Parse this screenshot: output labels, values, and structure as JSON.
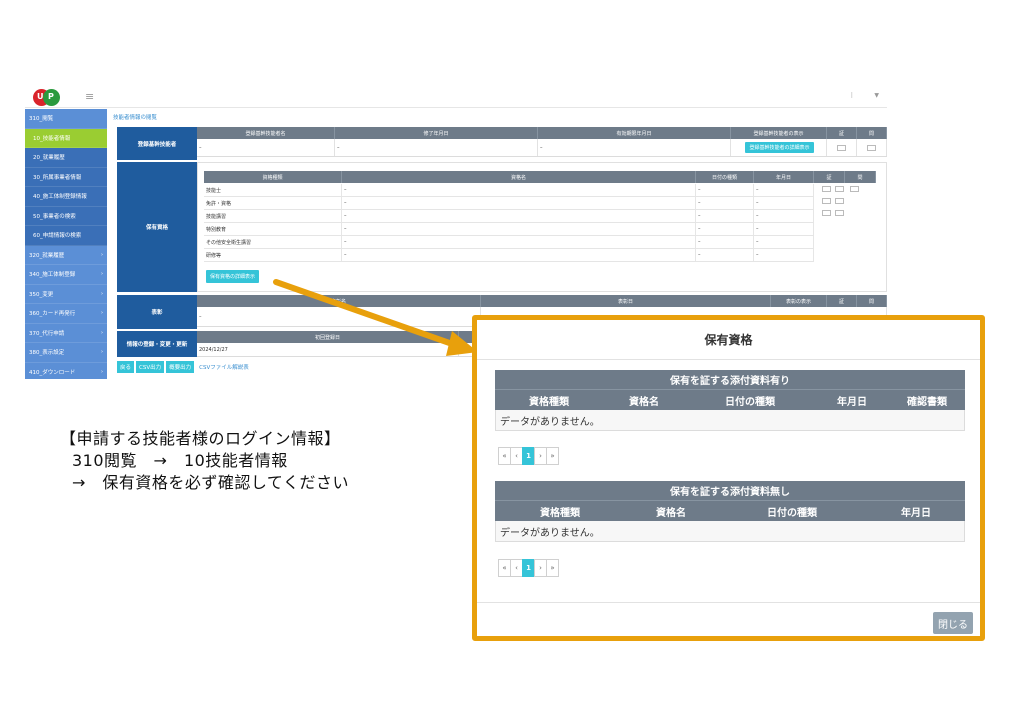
{
  "header": {
    "logo_text_1": "U",
    "logo_text_2": "P",
    "menu_icon": "menu-icon"
  },
  "sidebar": {
    "items": [
      {
        "label": "310_閲覧",
        "type": "top"
      },
      {
        "label": "10_技能者情報",
        "type": "active"
      },
      {
        "label": "20_就業履歴",
        "type": "sub"
      },
      {
        "label": "30_所属事業者情報",
        "type": "sub"
      },
      {
        "label": "40_施工体制登録情報",
        "type": "sub"
      },
      {
        "label": "50_事業者の検索",
        "type": "sub"
      },
      {
        "label": "60_申請情報の検索",
        "type": "sub"
      },
      {
        "label": "320_就業履歴",
        "type": "top"
      },
      {
        "label": "340_施工体制登録",
        "type": "top"
      },
      {
        "label": "350_変更",
        "type": "top"
      },
      {
        "label": "360_カード再発行",
        "type": "top"
      },
      {
        "label": "370_代行申請",
        "type": "top"
      },
      {
        "label": "380_表示設定",
        "type": "top"
      },
      {
        "label": "410_ダウンロード",
        "type": "top"
      }
    ]
  },
  "main": {
    "breadcrumb": "技能者情報の閲覧",
    "basic_skill": {
      "label": "登録基幹技能者",
      "headers": [
        "登録基幹技能者名",
        "修了年月日",
        "有効期限年月日",
        "登録基幹技能者の表示",
        "証",
        "問"
      ],
      "values": [
        "–",
        "–",
        "–"
      ],
      "detail_btn": "登録基幹技能者の詳細表示"
    },
    "quals": {
      "label": "保有資格",
      "headers": [
        "資格種類",
        "資格名",
        "日付の種類",
        "年月日",
        "証",
        "問"
      ],
      "rows": [
        {
          "type": "技能士",
          "name": "–",
          "date_type": "–",
          "date": "–"
        },
        {
          "type": "免許・資格",
          "name": "–",
          "date_type": "–",
          "date": "–"
        },
        {
          "type": "技能講習",
          "name": "–",
          "date_type": "–",
          "date": "–"
        },
        {
          "type": "特別教育",
          "name": "–",
          "date_type": "–",
          "date": "–"
        },
        {
          "type": "その他安全衛生講習",
          "name": "–",
          "date_type": "–",
          "date": "–"
        },
        {
          "type": "研修等",
          "name": "–",
          "date_type": "–",
          "date": "–"
        }
      ],
      "detail_btn": "保有資格の詳細表示"
    },
    "awards": {
      "label": "表彰",
      "headers": [
        "表彰名",
        "表彰日",
        "表彰の表示",
        "証",
        "問"
      ],
      "value": "–"
    },
    "info_reg": {
      "label": "情報の登録・変更・更新",
      "header": "初回登録日",
      "value": "2024/12/27",
      "value2": "202"
    },
    "buttons": {
      "back": "戻る",
      "csv": "CSV出力",
      "summary": "概要出力",
      "csv_link": "CSVファイル解説表"
    }
  },
  "instructions": {
    "line1": "【申請する技能者様のログイン情報】",
    "line2": "310閲覧　→　10技能者情報",
    "line3": "→　保有資格を必ず確認してください"
  },
  "modal": {
    "title": "保有資格",
    "table1": {
      "caption": "保有を証する添付資料有り",
      "headers": [
        "資格種類",
        "資格名",
        "日付の種類",
        "年月日",
        "確認書類"
      ],
      "empty": "データがありません。"
    },
    "table2": {
      "caption": "保有を証する添付資料無し",
      "headers": [
        "資格種類",
        "資格名",
        "日付の種類",
        "年月日"
      ],
      "empty": "データがありません。"
    },
    "pager": {
      "first": "«",
      "prev": "‹",
      "page": "1",
      "next": "›",
      "last": "»"
    },
    "close_btn": "閉じる"
  },
  "colors": {
    "highlight_border": "#e8a00c",
    "arrow": "#e8a00c",
    "table_header": "#6e7b89",
    "accent": "#35c4d8",
    "sidebar": "#5b8fd6",
    "section_label": "#1f5c9e"
  }
}
